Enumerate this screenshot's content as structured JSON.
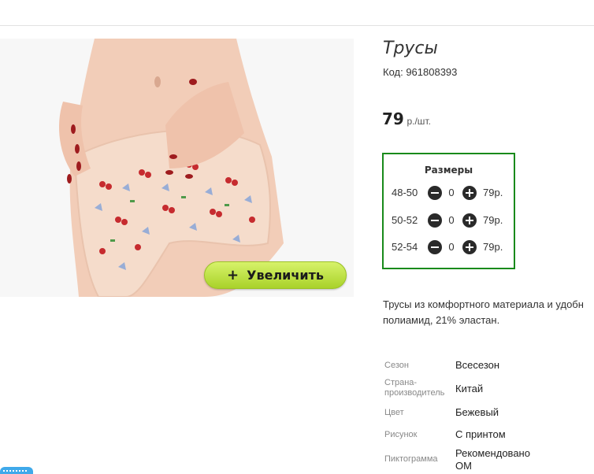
{
  "product": {
    "title": "Трусы",
    "code": "Код: 961808393",
    "price_value": "79",
    "price_unit": "р./шт.",
    "zoom_label": "Увеличить",
    "zoom_plus": "+",
    "description_line1": "Трусы из комфортного материала и удобн",
    "description_line2": "полиамид, 21% эластан."
  },
  "sizes": {
    "title": "Размеры",
    "rows": [
      {
        "label": "48-50",
        "qty": "0",
        "price": "79р."
      },
      {
        "label": "50-52",
        "qty": "0",
        "price": "79р."
      },
      {
        "label": "52-54",
        "qty": "0",
        "price": "79р."
      }
    ]
  },
  "specs": [
    {
      "key": "Сезон",
      "value": "Всесезон"
    },
    {
      "key": "Страна-\nпроизводитель",
      "value": "Китай"
    },
    {
      "key": "Цвет",
      "value": "Бежевый"
    },
    {
      "key": "Рисунок",
      "value": "С принтом"
    },
    {
      "key": "Пиктограмма",
      "value": "Рекомендовано\nОМ"
    }
  ],
  "colors": {
    "sizes_border": "#198a1b",
    "zoom_button": "#b5db3a",
    "chat_tab": "#3fa9ea"
  }
}
